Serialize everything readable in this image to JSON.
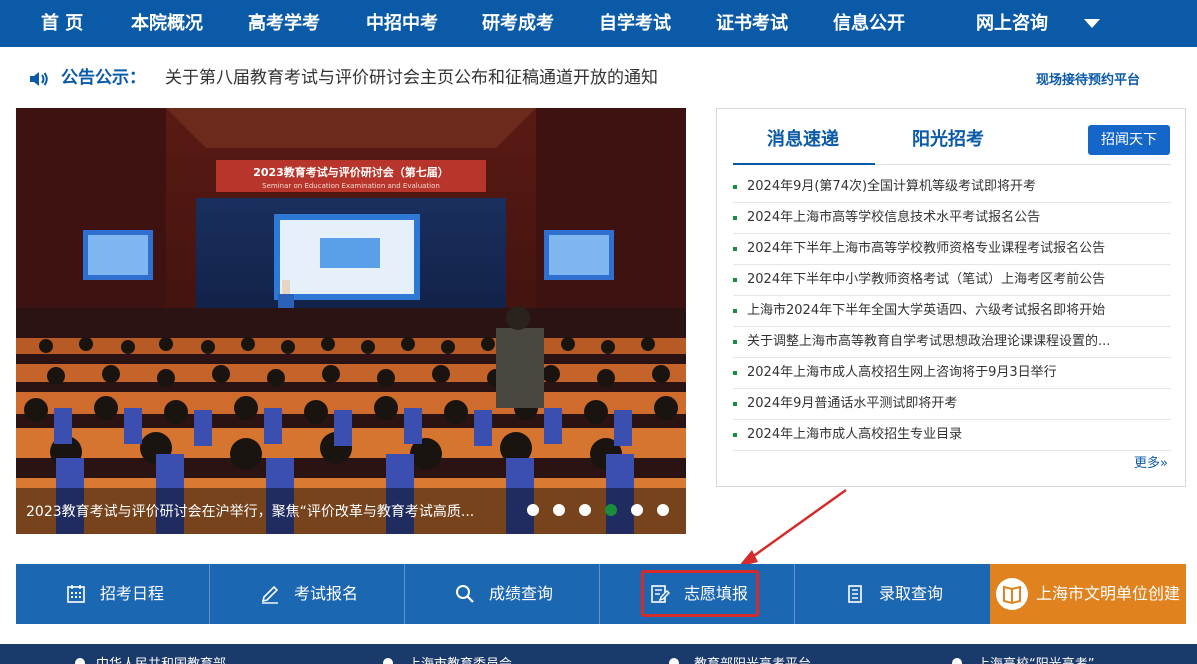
{
  "nav": {
    "items": [
      "首 页",
      "本院概况",
      "高考学考",
      "中招中考",
      "研考成考",
      "自学考试",
      "证书考试",
      "信息公开",
      "网上咨询"
    ]
  },
  "notice": {
    "label": "公告公示：",
    "text": "关于第八届教育考试与评价研讨会主页公布和征稿通道开放的通知",
    "reserve_link": "现场接待预约平台"
  },
  "slider": {
    "banner_title": "2023教育考试与评价研讨会（第七届）",
    "banner_subtitle": "Seminar on Education Examination and Evaluation",
    "caption": "2023教育考试与评价研讨会在沪举行，聚焦“评价改革与教育考试高质...",
    "slide_count": 6,
    "active_slide": 4
  },
  "news": {
    "tabs": [
      "消息速递",
      "阳光招考"
    ],
    "button": "招闻天下",
    "items": [
      "2024年9月(第74次)全国计算机等级考试即将开考",
      "2024年上海市高等学校信息技术水平考试报名公告",
      "2024年下半年上海市高等学校教师资格专业课程考试报名公告",
      "2024年下半年中小学教师资格考试（笔试）上海考区考前公告",
      "上海市2024年下半年全国大学英语四、六级考试报名即将开始",
      "关于调整上海市高等教育自学考试思想政治理论课课程设置的...",
      "2024年上海市成人高校招生网上咨询将于9月3日举行",
      "2024年9月普通话水平测试即将开考",
      "2024年上海市成人高校招生专业目录"
    ],
    "more": "更多»"
  },
  "quick": {
    "items": [
      "招考日程",
      "考试报名",
      "成绩查询",
      "志愿填报",
      "录取查询"
    ],
    "orange": "上海市文明单位创建"
  },
  "footer": {
    "links": [
      "中华人民共和国教育部",
      "上海市教育委员会",
      "教育部阳光高考平台",
      "上海高校“阳光高考”"
    ]
  },
  "colors": {
    "nav_bg": "#0a5aa8",
    "quick_bg": "#1c67b1",
    "orange": "#e0821e",
    "bullet_green": "#1a8d3c",
    "highlight_red": "#d42b2b"
  }
}
